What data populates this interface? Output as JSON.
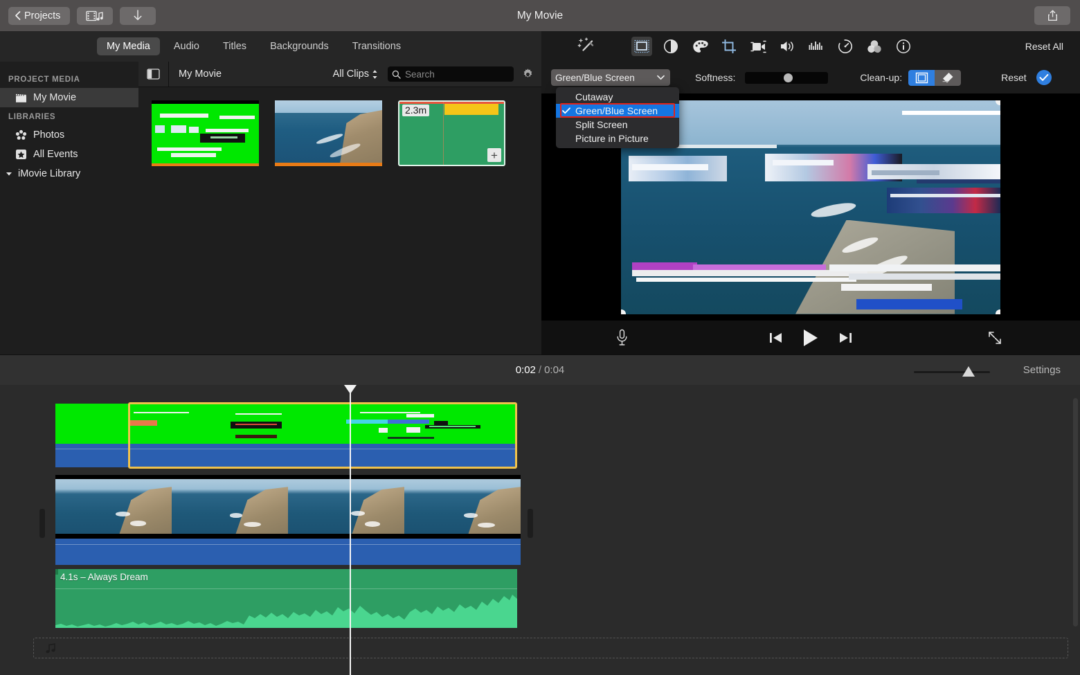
{
  "titlebar": {
    "back_label": "Projects",
    "title": "My Movie",
    "media_button_icon": "filmstrip-music-icon",
    "import_button_icon": "download-arrow-icon",
    "share_button_icon": "share-icon"
  },
  "tabs": [
    {
      "label": "My Media",
      "active": true
    },
    {
      "label": "Audio",
      "active": false
    },
    {
      "label": "Titles",
      "active": false
    },
    {
      "label": "Backgrounds",
      "active": false
    },
    {
      "label": "Transitions",
      "active": false
    }
  ],
  "sidebar": {
    "sections": [
      {
        "header": "PROJECT MEDIA",
        "items": [
          {
            "label": "My Movie",
            "icon": "clapperboard-icon",
            "active": true
          }
        ]
      },
      {
        "header": "LIBRARIES",
        "items": [
          {
            "label": "Photos",
            "icon": "photos-flower-icon",
            "active": false
          },
          {
            "label": "All Events",
            "icon": "star-box-icon",
            "active": false
          }
        ]
      }
    ],
    "library_root": {
      "label": "iMovie Library",
      "icon": "disclosure-triangle-icon"
    }
  },
  "media_browser": {
    "sidebar_toggle_icon": "sidebar-toggle-icon",
    "project_name": "My Movie",
    "filter_label": "All Clips",
    "filter_icon": "updown-chevron-icon",
    "search_icon": "search-icon",
    "search_placeholder": "Search",
    "search_value": "",
    "gear_icon": "gear-icon",
    "clips": [
      {
        "name": "green-screen-clip",
        "type": "video",
        "selected": false
      },
      {
        "name": "ocean-cliff-clip",
        "type": "video",
        "selected": false
      },
      {
        "name": "audio-clip",
        "type": "audio",
        "duration": "2.3m",
        "add_label": "+",
        "selected": true
      }
    ]
  },
  "inspector": {
    "wand_icon": "magic-wand-icon",
    "reset_all_label": "Reset All",
    "icons": [
      {
        "name": "video-overlay-icon",
        "selected": true
      },
      {
        "name": "color-balance-icon",
        "selected": false
      },
      {
        "name": "color-correction-icon",
        "selected": false
      },
      {
        "name": "crop-icon",
        "selected": false
      },
      {
        "name": "stabilization-icon",
        "selected": false
      },
      {
        "name": "volume-icon",
        "selected": false
      },
      {
        "name": "noise-reduction-icon",
        "selected": false
      },
      {
        "name": "speed-icon",
        "selected": false
      },
      {
        "name": "filters-icon",
        "selected": false
      },
      {
        "name": "info-icon",
        "selected": false
      }
    ]
  },
  "overlay_controls": {
    "mode_value": "Green/Blue Screen",
    "mode_chevron": "chevron-down-icon",
    "softness_label": "Softness:",
    "softness_value": 45,
    "cleanup_label": "Clean-up:",
    "cleanup_crop_icon": "crop-mask-icon",
    "cleanup_eraser_icon": "eraser-icon",
    "cleanup_selected": "crop-mask",
    "reset_label": "Reset",
    "apply_icon": "checkmark-icon"
  },
  "dropdown": {
    "open": true,
    "highlighted_index": 1,
    "items": [
      {
        "label": "Cutaway",
        "checked": false
      },
      {
        "label": "Green/Blue Screen",
        "checked": true
      },
      {
        "label": "Split Screen",
        "checked": false
      },
      {
        "label": "Picture in Picture",
        "checked": false
      }
    ],
    "highlight_color": "#e2231a",
    "selection_color": "#1476e2"
  },
  "playback": {
    "mic_icon": "microphone-icon",
    "prev_icon": "skip-previous-icon",
    "play_icon": "play-icon",
    "next_icon": "skip-next-icon",
    "fullscreen_icon": "fullscreen-icon"
  },
  "timeline_header": {
    "current_time": "0:02",
    "separator": "/",
    "total_time": "0:04",
    "zoom_value": 64,
    "settings_label": "Settings"
  },
  "timeline": {
    "playhead_time": "0:02",
    "clips": [
      {
        "name": "overlay-green-screen-clip",
        "kind": "video-overlay",
        "selected": true
      },
      {
        "name": "main-ocean-clip",
        "kind": "video",
        "selected": false
      },
      {
        "name": "music-clip",
        "kind": "audio",
        "label": "4.1s – Always Dream",
        "selected": false
      }
    ],
    "dropzone_icon": "music-note-icon"
  },
  "colors": {
    "accent_blue": "#2f7fe0",
    "selection_yellow": "#f0c24b",
    "green_screen": "#00e800",
    "audio_green": "#2e9e63",
    "audio_blue": "#2b5fb0",
    "highlight_red": "#e2231a"
  }
}
